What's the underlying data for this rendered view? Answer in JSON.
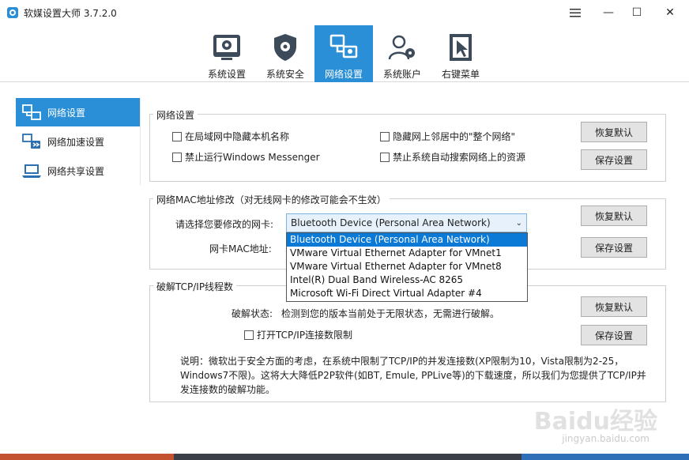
{
  "window": {
    "title": "软媒设置大师 3.7.2.0",
    "minimize_glyph": "—",
    "restore_glyph": "▭",
    "maximize_glyph": "☐",
    "close_glyph": "✕"
  },
  "toolbar": {
    "tabs": [
      {
        "label": "系统设置",
        "icon": "system-settings-icon"
      },
      {
        "label": "系统安全",
        "icon": "shield-icon"
      },
      {
        "label": "网络设置",
        "icon": "network-icon",
        "active": true
      },
      {
        "label": "系统账户",
        "icon": "users-icon"
      },
      {
        "label": "右键菜单",
        "icon": "cursor-menu-icon"
      }
    ]
  },
  "sidebar": {
    "items": [
      {
        "label": "网络设置",
        "icon": "network-icon",
        "active": true
      },
      {
        "label": "网络加速设置",
        "icon": "accelerate-icon"
      },
      {
        "label": "网络共享设置",
        "icon": "laptop-share-icon"
      }
    ]
  },
  "network_settings": {
    "title": "网络设置",
    "options": [
      {
        "label": "在局域网中隐藏本机名称",
        "checked": false
      },
      {
        "label": "隐藏网上邻居中的\"整个网络\"",
        "checked": false
      },
      {
        "label": "禁止运行Windows Messenger",
        "checked": false
      },
      {
        "label": "禁止系统自动搜索网络上的资源",
        "checked": false
      }
    ],
    "restore_label": "恢复默认",
    "save_label": "保存设置"
  },
  "mac_settings": {
    "title": "网络MAC地址修改（对无线网卡的修改可能会不生效）",
    "select_label": "请选择您要修改的网卡:",
    "mac_label": "网卡MAC地址:",
    "selected_adapter": "Bluetooth Device (Personal Area Network)",
    "adapters": [
      "Bluetooth Device (Personal Area Network)",
      "VMware Virtual Ethernet Adapter for VMnet1",
      "VMware Virtual Ethernet Adapter for VMnet8",
      "Intel(R) Dual Band Wireless-AC 8265",
      "Microsoft Wi-Fi Direct Virtual Adapter #4"
    ],
    "restore_label": "恢复默认",
    "save_label": "保存设置"
  },
  "tcp_settings": {
    "title": "破解TCP/IP线程数",
    "status_label": "破解状态:",
    "status_text": "检测到您的版本当前处于无限状态，无需进行破解。",
    "open_limit_label": "打开TCP/IP连接数限制",
    "open_limit_checked": false,
    "restore_label": "恢复默认",
    "save_label": "保存设置",
    "description": "说明：微软出于安全方面的考虑，在系统中限制了TCP/IP的并发连接数(XP限制为10，Vista限制为2-25，Windows7不限)。这将大大降低P2P软件(如BT, Emule, PPLive等)的下载速度，所以我们为您提供了TCP/IP并发连接数的破解功能。"
  },
  "watermark": {
    "brand": "Baidu经验",
    "url": "jingyan.baidu.com"
  },
  "colors": {
    "accent": "#2a8fd6",
    "selection": "#0a7ad6",
    "taskbar": "#b9432e"
  }
}
